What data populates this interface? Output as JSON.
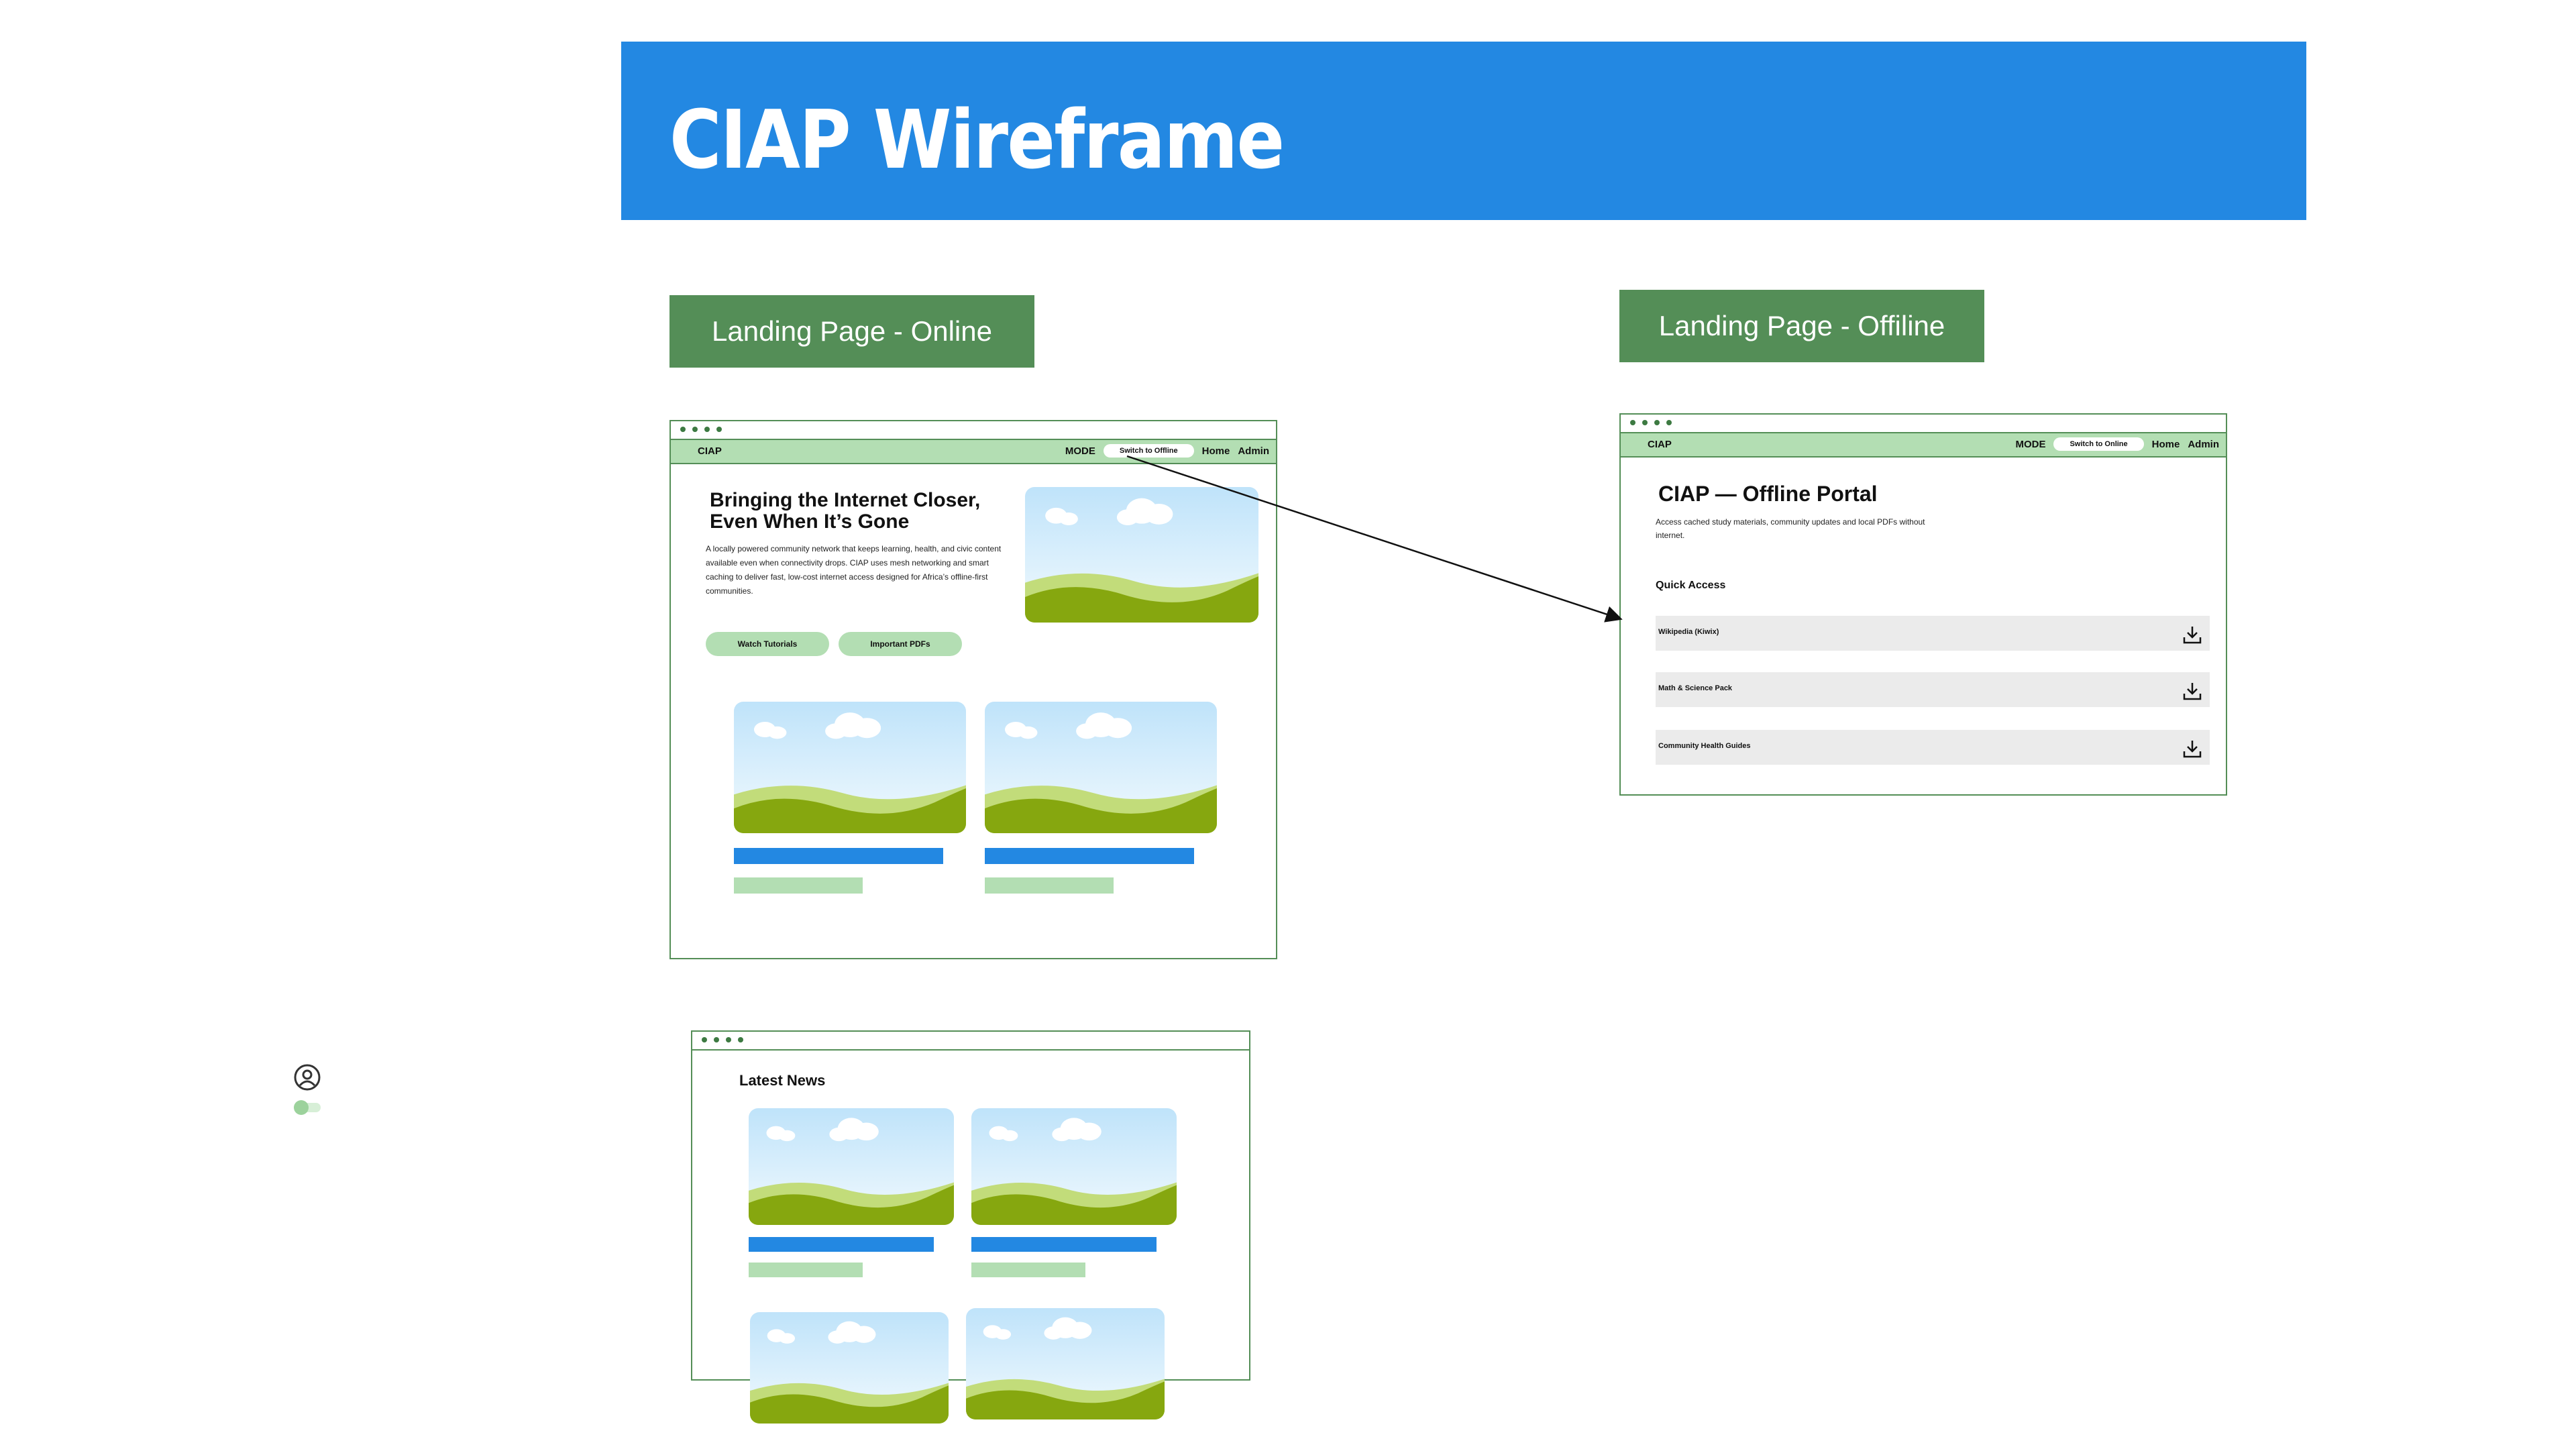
{
  "banner": {
    "title": "CIAP Wireframe",
    "color": "#2388E2"
  },
  "labels": {
    "online": "Landing Page - Online",
    "offline": "Landing Page - Offiline",
    "color": "#548E57"
  },
  "online_page": {
    "brand": "CIAP",
    "mode": "MODE",
    "switch": "Switch to Offline",
    "home": "Home",
    "admin": "Admin",
    "hero_title_1": "Bringing the Internet Closer,",
    "hero_title_2": "Even When It’s Gone",
    "hero_body": "A locally powered community network that keeps learning, health, and civic content available even when connectivity drops. CIAP uses mesh networking and smart caching to deliver fast, low-cost internet access designed for Africa’s offline-first communities.",
    "btn_tutorials": "Watch Tutorials",
    "btn_pdfs": "Important PDFs"
  },
  "offline_page": {
    "brand": "CIAP",
    "mode": "MODE",
    "switch": "Switch to Online",
    "home": "Home",
    "admin": "Admin",
    "title": "CIAP — Offline Portal",
    "subtitle": "Access cached study materials, community updates and local PDFs without internet.",
    "quick_access": "Quick Access",
    "items": [
      "Wikipedia (Kiwix)",
      "Math & Science Pack",
      "Community Health Guides"
    ]
  },
  "news_page": {
    "title": "Latest News"
  },
  "icons": {
    "avatar": "user-circle-icon",
    "toggle": "toggle-icon",
    "download": "download-icon"
  }
}
